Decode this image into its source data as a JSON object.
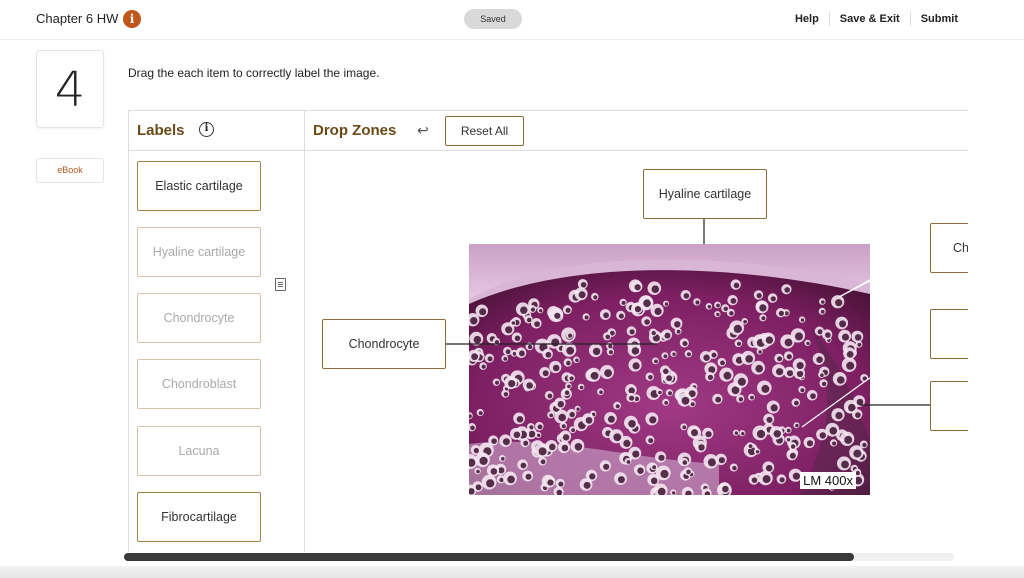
{
  "header": {
    "assignment_title": "Chapter 6 HW",
    "info_icon": "info-icon",
    "saved_label": "Saved",
    "help_label": "Help",
    "save_exit_label": "Save & Exit",
    "submit_label": "Submit"
  },
  "question": {
    "number": "4",
    "ebook_label": "eBook",
    "prompt": "Drag the each item to correctly label the image."
  },
  "labels_panel": {
    "title": "Labels",
    "items": [
      {
        "text": "Elastic cartilage",
        "used": false
      },
      {
        "text": "Hyaline cartilage",
        "used": true
      },
      {
        "text": "Chondrocyte",
        "used": true
      },
      {
        "text": "Chondroblast",
        "used": true
      },
      {
        "text": "Lacuna",
        "used": true
      },
      {
        "text": "Fibrocartilage",
        "used": false
      }
    ]
  },
  "drop_panel": {
    "title": "Drop Zones",
    "reset_label": "Reset All",
    "image_caption": "LM 400x",
    "zones": [
      {
        "id": "top",
        "text": "Hyaline cartilage"
      },
      {
        "id": "left",
        "text": "Chondrocyte"
      },
      {
        "id": "right-1",
        "text": "Ch"
      },
      {
        "id": "right-2",
        "text": ""
      },
      {
        "id": "right-3",
        "text": ""
      }
    ]
  },
  "colors": {
    "accent_brown": "#6b4a17",
    "submit": "#7a1e1e",
    "tissue_matrix": "#8e2a6e",
    "tissue_light": "#e9c9e6"
  }
}
